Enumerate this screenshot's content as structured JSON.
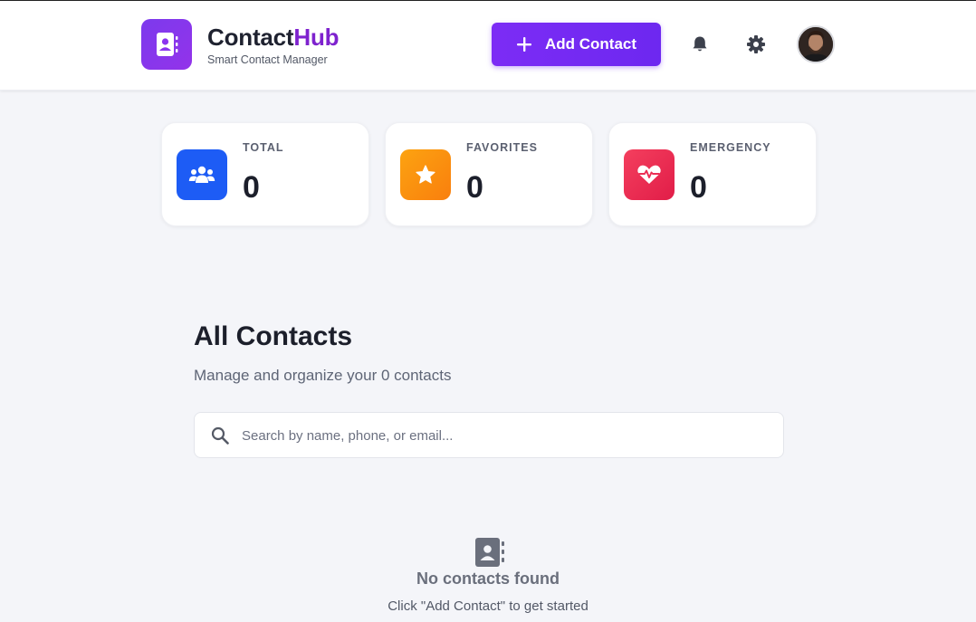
{
  "header": {
    "brand_main": "Contact",
    "brand_accent": "Hub",
    "brand_subtitle": "Smart Contact Manager",
    "add_button_label": "Add Contact",
    "notifications_icon": "bell-icon",
    "settings_icon": "gear-icon"
  },
  "stats": [
    {
      "label": "TOTAL",
      "value": "0",
      "icon": "users-icon",
      "color": "#1d5cf5"
    },
    {
      "label": "FAVORITES",
      "value": "0",
      "icon": "star-icon",
      "color": "#fb8c00"
    },
    {
      "label": "EMERGENCY",
      "value": "0",
      "icon": "heart-pulse-icon",
      "color": "#f43f5e"
    }
  ],
  "contacts": {
    "title": "All Contacts",
    "subtitle": "Manage and organize your 0 contacts",
    "search_placeholder": "Search by name, phone, or email...",
    "search_value": ""
  },
  "empty_state": {
    "title": "No contacts found",
    "subtitle": "Click \"Add Contact\" to get started",
    "icon": "address-book-icon"
  },
  "colors": {
    "brand_purple": "#7e22ce",
    "button_purple": "#7c2cf5",
    "background": "#f4f5f9"
  }
}
